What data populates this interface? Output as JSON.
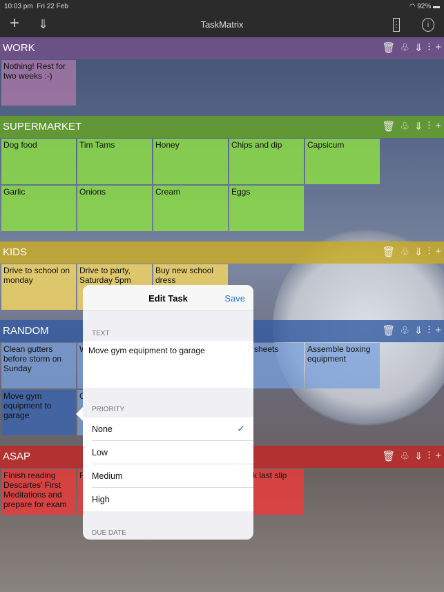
{
  "status": {
    "time": "10:03 pm",
    "date": "Fri 22 Feb",
    "battery": "92%"
  },
  "nav": {
    "title": "TaskMatrix"
  },
  "sections": [
    {
      "name": "WORK",
      "cards": [
        "Nothing! Rest for two weeks :-)"
      ]
    },
    {
      "name": "SUPERMARKET",
      "cards": [
        "Dog food",
        "Tim Tams",
        "Honey",
        "Chips and dip",
        "Capsicum",
        "Garlic",
        "Onions",
        "Cream",
        "Eggs"
      ]
    },
    {
      "name": "KIDS",
      "cards": [
        "Drive to school on monday",
        "Drive to party, Saturday 5pm",
        "Buy new school dress"
      ]
    },
    {
      "name": "RANDOM",
      "cards": [
        "Clean gutters before storm on Sunday",
        "W b",
        "sheets",
        "Assemble boxing equipment",
        "Move gym equipment to garage",
        "C"
      ]
    },
    {
      "name": "ASAP",
      "cards": [
        "Finish reading Descartes' First Meditations and prepare for exam",
        "F c",
        "k last slip"
      ]
    }
  ],
  "popover": {
    "title": "Edit Task",
    "save": "Save",
    "text_label": "TEXT",
    "text_value": "Move gym equipment to garage",
    "priority_label": "PRIORITY",
    "priorities": [
      "None",
      "Low",
      "Medium",
      "High"
    ],
    "selected_priority": "None",
    "due_label": "DUE DATE"
  }
}
